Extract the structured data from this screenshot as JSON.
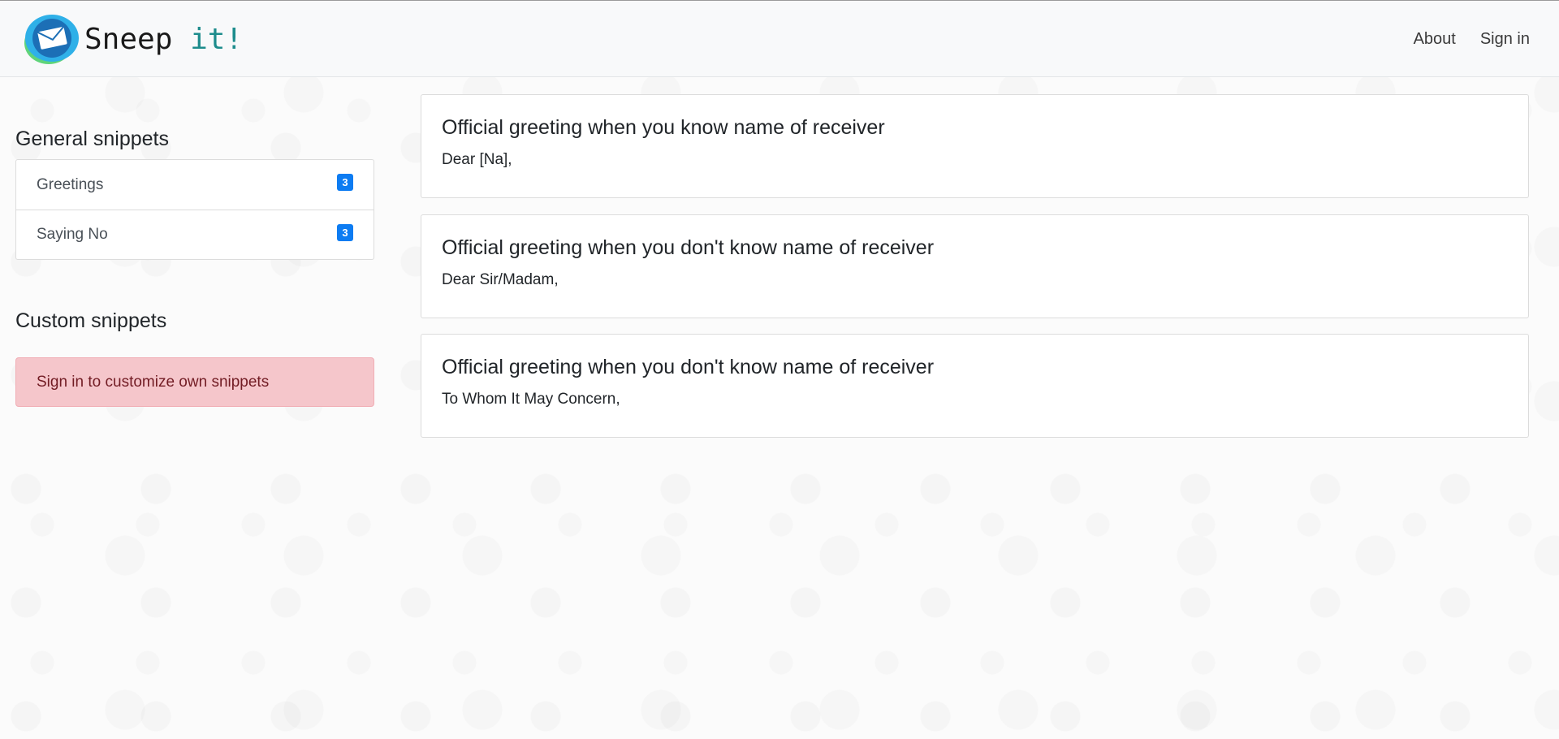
{
  "app": {
    "brand_word1": "Sneep",
    "brand_word2": "it!",
    "logo_icon": "envelope-logo-icon"
  },
  "nav": {
    "about": "About",
    "sign_in": "Sign in"
  },
  "sidebar": {
    "general_title": "General snippets",
    "general_items": [
      {
        "label": "Greetings",
        "count": "3"
      },
      {
        "label": "Saying No",
        "count": "3"
      }
    ],
    "custom_title": "Custom snippets",
    "custom_alert": "Sign in to customize own snippets"
  },
  "snippets": [
    {
      "title": "Official greeting when you know name of receiver",
      "text": "Dear [Na],"
    },
    {
      "title": "Official greeting when you don't know name of receiver",
      "text": "Dear Sir/Madam,"
    },
    {
      "title": "Official greeting when you don't know name of receiver",
      "text": "To Whom It May Concern,"
    }
  ],
  "colors": {
    "badge": "#0d7cf2",
    "alert_bg": "#f5c6cb",
    "brand_accent": "#1d8c8c",
    "navbar_bg": "#f8f9fa"
  }
}
